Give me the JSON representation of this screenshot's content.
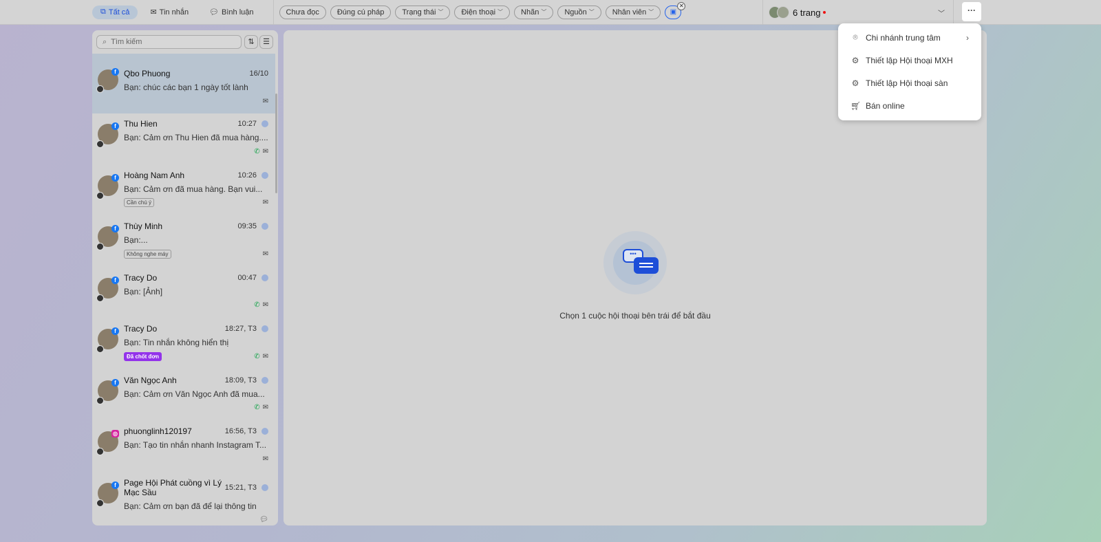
{
  "tabs": [
    {
      "label": "Tất cả",
      "icon": "copy-icon"
    },
    {
      "label": "Tin nhắn",
      "icon": "mail-icon"
    },
    {
      "label": "Bình luận",
      "icon": "comment-icon"
    }
  ],
  "filters": [
    "Chưa đọc",
    "Đúng cú pháp",
    "Trạng thái",
    "Điện thoại",
    "Nhãn",
    "Nguồn",
    "Nhân viên"
  ],
  "pages": {
    "label": "6 trang"
  },
  "search": {
    "placeholder": "Tìm kiếm"
  },
  "conversations": [
    {
      "name": "Qbo Phuong",
      "time": "16/10",
      "msg": "Bạn: chúc các bạn 1 ngày tốt lành",
      "platform": "facebook",
      "phone": false,
      "tag": "",
      "selected": true,
      "icon": "mail"
    },
    {
      "name": "Thu Hien",
      "time": "10:27",
      "msg": "Bạn: Cảm ơn Thu Hien đã mua hàng....",
      "platform": "facebook",
      "phone": true,
      "tag": "",
      "icon": "mail"
    },
    {
      "name": "Hoàng Nam Anh",
      "time": "10:26",
      "msg": "Bạn: Cảm ơn đã mua hàng. Bạn vui...",
      "platform": "facebook",
      "phone": false,
      "tag": "Cần chú ý",
      "icon": "mail"
    },
    {
      "name": "Thùy Minh",
      "time": "09:35",
      "msg": "Bạn:...",
      "platform": "facebook",
      "phone": false,
      "tag": "Không nghe máy",
      "icon": "mail"
    },
    {
      "name": "Tracy Do",
      "time": "00:47",
      "msg": "Bạn: [Ảnh]",
      "platform": "facebook",
      "phone": true,
      "tag": "",
      "icon": "mail"
    },
    {
      "name": "Tracy Do",
      "time": "18:27, T3",
      "msg": "Bạn: Tin nhắn không hiển thị",
      "platform": "facebook",
      "phone": true,
      "tag": "Đã chốt đơn",
      "tagColor": "#9333ea",
      "icon": "mail"
    },
    {
      "name": "Văn Ngọc Anh",
      "time": "18:09, T3",
      "msg": "Bạn: Cảm ơn Văn Ngọc Anh đã mua...",
      "platform": "facebook",
      "phone": true,
      "tag": "",
      "icon": "mail"
    },
    {
      "name": "phuonglinh120197",
      "time": "16:56, T3",
      "msg": "Bạn: Tạo tin nhắn nhanh Instagram T...",
      "platform": "instagram",
      "phone": false,
      "tag": "",
      "icon": "mail"
    },
    {
      "name": "Page Hội Phát cuồng vì Lý Mạc Sầu",
      "time": "15:21, T3",
      "msg": "Bạn: Cảm ơn bạn đã để lại thông tin",
      "platform": "facebook",
      "phone": false,
      "tag": "",
      "icon": "comment"
    }
  ],
  "main": {
    "empty_text": "Chọn 1 cuộc hội thoại bên trái để bắt đầu"
  },
  "menu": [
    {
      "label": "Chi nhánh trung tâm",
      "icon": "location-icon",
      "submenu": true
    },
    {
      "label": "Thiết lập Hội thoại MXH",
      "icon": "gear-icon"
    },
    {
      "label": "Thiết lập Hội thoại sàn",
      "icon": "gear-icon"
    },
    {
      "label": "Bán online",
      "icon": "cart-icon"
    }
  ]
}
